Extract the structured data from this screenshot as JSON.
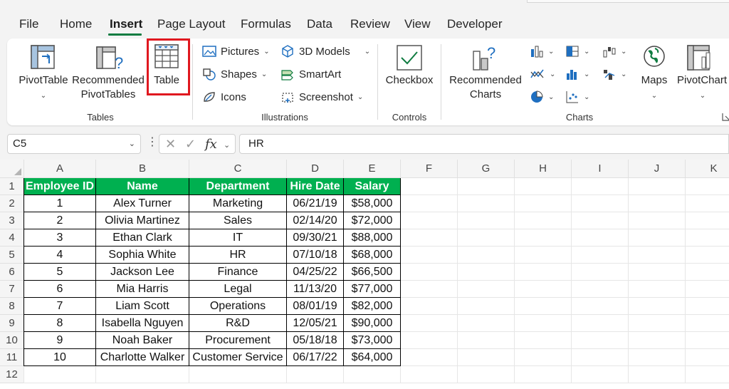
{
  "menu": {
    "items": [
      "File",
      "Home",
      "Insert",
      "Page Layout",
      "Formulas",
      "Data",
      "Review",
      "View",
      "Developer"
    ],
    "active": "Insert"
  },
  "ribbon": {
    "tables": {
      "pivottable_line1": "PivotTable",
      "recommended_line1": "Recommended",
      "recommended_line2": "PivotTables",
      "table": "Table",
      "group": "Tables"
    },
    "illustrations": {
      "pictures": "Pictures",
      "shapes": "Shapes",
      "icons": "Icons",
      "models_3d": "3D Models",
      "smartart": "SmartArt",
      "screenshot": "Screenshot",
      "group": "Illustrations"
    },
    "controls": {
      "checkbox": "Checkbox",
      "group": "Controls"
    },
    "charts": {
      "recommended_line1": "Recommended",
      "recommended_line2": "Charts",
      "maps": "Maps",
      "pivotchart": "PivotChart",
      "group": "Charts"
    }
  },
  "formula_bar": {
    "name_box": "C5",
    "fx": "fx",
    "content": "HR"
  },
  "sheet": {
    "columns": [
      "A",
      "B",
      "C",
      "D",
      "E",
      "F",
      "G",
      "H",
      "I",
      "J",
      "K"
    ],
    "rows": [
      "1",
      "2",
      "3",
      "4",
      "5",
      "6",
      "7",
      "8",
      "9",
      "10",
      "11",
      "12"
    ],
    "table_headers": [
      "Employee ID",
      "Name",
      "Department",
      "Hire Date",
      "Salary"
    ],
    "table_rows": [
      [
        "1",
        "Alex Turner",
        "Marketing",
        "06/21/19",
        "$58,000"
      ],
      [
        "2",
        "Olivia Martinez",
        "Sales",
        "02/14/20",
        "$72,000"
      ],
      [
        "3",
        "Ethan Clark",
        "IT",
        "09/30/21",
        "$88,000"
      ],
      [
        "4",
        "Sophia White",
        "HR",
        "07/10/18",
        "$68,000"
      ],
      [
        "5",
        "Jackson Lee",
        "Finance",
        "04/25/22",
        "$66,500"
      ],
      [
        "6",
        "Mia Harris",
        "Legal",
        "11/13/20",
        "$77,000"
      ],
      [
        "7",
        "Liam Scott",
        "Operations",
        "08/01/19",
        "$82,000"
      ],
      [
        "8",
        "Isabella Nguyen",
        "R&D",
        "12/05/21",
        "$90,000"
      ],
      [
        "9",
        "Noah Baker",
        "Procurement",
        "05/18/18",
        "$73,000"
      ],
      [
        "10",
        "Charlotte Walker",
        "Customer Service",
        "06/17/22",
        "$64,000"
      ]
    ],
    "header_color": "#00b050"
  },
  "colors": {
    "accent": "#107c41",
    "highlight_box": "#e0181f"
  }
}
